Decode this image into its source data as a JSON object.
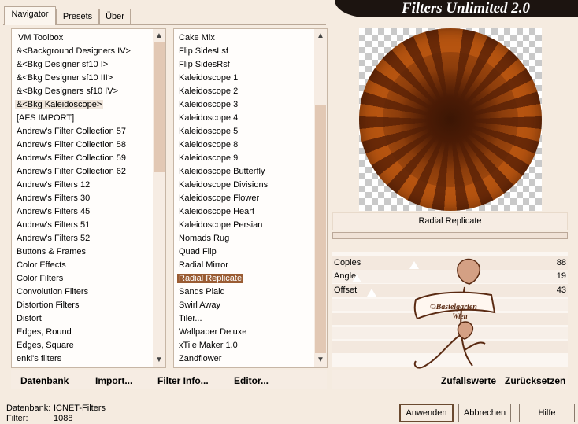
{
  "tabs": [
    "Navigator",
    "Presets",
    "Über"
  ],
  "header": {
    "title": "Filters Unlimited 2.0"
  },
  "categories": [
    "VM Toolbox",
    "&<Background Designers IV>",
    "&<Bkg Designer sf10 I>",
    "&<Bkg Designer sf10 III>",
    "&<Bkg Designers sf10 IV>",
    "&<Bkg Kaleidoscope>",
    "[AFS IMPORT]",
    "Andrew's Filter Collection 57",
    "Andrew's Filter Collection 58",
    "Andrew's Filter Collection 59",
    "Andrew's Filter Collection 62",
    "Andrew's Filters 12",
    "Andrew's Filters 30",
    "Andrew's Filters 45",
    "Andrew's Filters 51",
    "Andrew's Filters 52",
    "Buttons & Frames",
    "Color Effects",
    "Color Filters",
    "Convolution Filters",
    "Distortion Filters",
    "Distort",
    "Edges, Round",
    "Edges, Square",
    "enki's filters"
  ],
  "filters": [
    "Cake Mix",
    "Flip SidesLsf",
    "Flip SidesRsf",
    "Kaleidoscope 1",
    "Kaleidoscope 2",
    "Kaleidoscope 3",
    "Kaleidoscope 4",
    "Kaleidoscope 5",
    "Kaleidoscope 8",
    "Kaleidoscope 9",
    "Kaleidoscope Butterfly",
    "Kaleidoscope Divisions",
    "Kaleidoscope Flower",
    "Kaleidoscope Heart",
    "Kaleidoscope Persian",
    "Nomads Rug",
    "Quad Flip",
    "Radial Mirror",
    "Radial Replicate",
    "Sands Plaid",
    "Swirl Away",
    "Tiler...",
    "Wallpaper Deluxe",
    "xTile Maker 1.0",
    "Zandflower"
  ],
  "preview": {
    "filter_name": "Radial Replicate"
  },
  "params": [
    {
      "label": "Copies",
      "value": "88"
    },
    {
      "label": "Angle",
      "value": "19"
    },
    {
      "label": "Offset",
      "value": "43"
    }
  ],
  "watermark": {
    "line1": "©Bastelgarten",
    "line2": "Wien"
  },
  "toolbar": {
    "database": "Datenbank",
    "import": "Import...",
    "filter_info": "Filter Info...",
    "editor": "Editor...",
    "random": "Zufallswerte",
    "reset": "Zurücksetzen"
  },
  "status": {
    "db_label": "Datenbank:",
    "db_value": "ICNET-Filters",
    "filter_label": "Filter:",
    "filter_value": "1088"
  },
  "actions": {
    "apply": "Anwenden",
    "cancel": "Abbrechen",
    "help": "Hilfe"
  },
  "colors": {
    "accent": "#9a5c33",
    "background": "#f5ebe0",
    "header": "#1c1410"
  }
}
